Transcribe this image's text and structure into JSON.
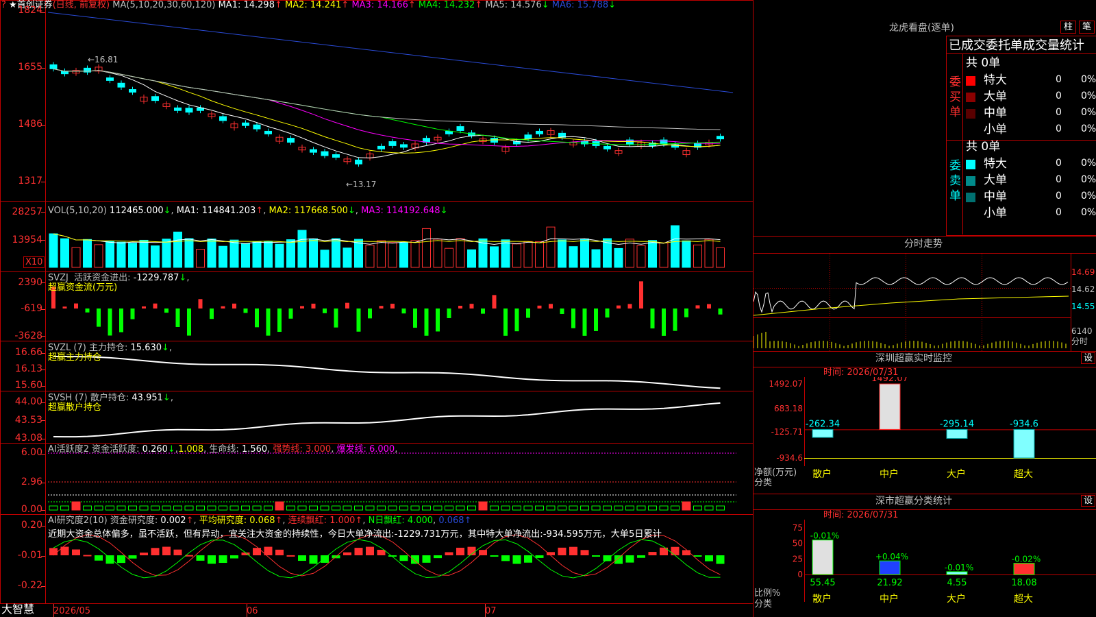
{
  "colors": {
    "up": "#ff3030",
    "down": "#00ffff",
    "frame": "#c00000",
    "ma1": "#ffffff",
    "ma2": "#ffff00",
    "ma3": "#ff00ff",
    "ma4": "#00ff00",
    "ma5": "#c0c0c0",
    "ma6": "#2a4bd7",
    "yellow": "#ffff00",
    "green": "#00ff00"
  },
  "header": {
    "marker": "?",
    "stock": "★首创证券",
    "period": "(日线, 前复权)",
    "ma_params": "MA(5,10,20,30,60,120)",
    "ma": [
      {
        "label": "MA1:",
        "value": "14.298",
        "arrow": "↑"
      },
      {
        "label": "MA2:",
        "value": "14.241",
        "arrow": "↑"
      },
      {
        "label": "MA3:",
        "value": "14.166",
        "arrow": "↑"
      },
      {
        "label": "MA4:",
        "value": "14.232",
        "arrow": "↑"
      },
      {
        "label": "MA5:",
        "value": "14.576",
        "arrow": "↓"
      },
      {
        "label": "MA6:",
        "value": "15.788",
        "arrow": "↓"
      }
    ]
  },
  "price_axis": [
    "1824",
    "1655",
    "1486",
    "1317"
  ],
  "price_marks": {
    "high": "←16.81",
    "low": "←13.17"
  },
  "vol": {
    "title": "VOL(5,10,20)",
    "value": "112465.000",
    "value_arrow": "↓",
    "ma": [
      {
        "label": "MA1:",
        "value": "114841.203",
        "arrow": "↑"
      },
      {
        "label": "MA2:",
        "value": "117668.500",
        "arrow": "↓"
      },
      {
        "label": "MA3:",
        "value": "114192.648",
        "arrow": "↓"
      }
    ],
    "axis": [
      "28257",
      "13954"
    ],
    "unit": "X10"
  },
  "svzj": {
    "title": "SVZJ",
    "label": "活跃资金进出:",
    "value": "-1229.787",
    "arrow": "↓",
    "sub": "超赢资金流(万元)",
    "axis": [
      "2390",
      "-619",
      "-3628"
    ]
  },
  "svzl": {
    "title": "SVZL (7)",
    "label": "主力持仓:",
    "value": "15.630",
    "arrow": "↓",
    "sub": "超赢主力持仓",
    "axis": [
      "16.66",
      "16.13",
      "15.60"
    ]
  },
  "svsh": {
    "title": "SVSH (7)",
    "label": "散户持仓:",
    "value": "43.951",
    "arrow": "↓",
    "sub": "超赢散户持仓",
    "axis": [
      "44.00",
      "43.53",
      "43.08"
    ]
  },
  "ai1": {
    "title": "AI活跃度2",
    "label": "资金活跃度:",
    "value": "0.260",
    "arrow": "↓",
    "v2": "1.008",
    "l3": "生命线:",
    "v3": "1.560",
    "l4": "强势线:",
    "v4": "3.000",
    "l5": "爆发线:",
    "v5": "6.000",
    "axis": [
      "6.00",
      "2.96",
      "0.00"
    ]
  },
  "ai2": {
    "title": "AI研究度2(10)",
    "label": "资金研究度:",
    "value": "0.002",
    "arrow": "↑",
    "l2": "平均研究度:",
    "v2": "0.068",
    "l3": "连续飘红:",
    "v3": "1.000",
    "l4": "N日飘红:",
    "v4": "4.000",
    "v5": "0.068",
    "axis": [
      "0.20",
      "-0.01",
      "-0.22"
    ],
    "comment": "近期大资金总体偏多，虽不活跃，但有异动，宜关注大资金的持续性，今日大单净流出:-1229.731万元，其中特大单净流出:-934.595万元，大单5日累计"
  },
  "footer": {
    "brand": "大智慧",
    "dates": [
      "2026/05",
      "06",
      "07"
    ]
  },
  "dragon": {
    "title": "龙虎看盘(逐单)",
    "btn1": "柱",
    "btn2": "笔",
    "table_title": "已成交委托单成交量统计",
    "buy": {
      "side": "委买单",
      "total": "共 0单",
      "rows": [
        {
          "name": "特大",
          "count": "0",
          "pct": "0%",
          "color": "#ff0000"
        },
        {
          "name": "大单",
          "count": "0",
          "pct": "0%",
          "color": "#8b0000"
        },
        {
          "name": "中单",
          "count": "0",
          "pct": "0%",
          "color": "#5a0000"
        },
        {
          "name": "小单",
          "count": "0",
          "pct": "0%",
          "color": "#000000"
        }
      ]
    },
    "sell": {
      "side": "委卖单",
      "total": "共 0单",
      "rows": [
        {
          "name": "特大",
          "count": "0",
          "pct": "0%",
          "color": "#00ffff"
        },
        {
          "name": "大单",
          "count": "0",
          "pct": "0%",
          "color": "#008b8b"
        },
        {
          "name": "中单",
          "count": "0",
          "pct": "0%",
          "color": "#007070"
        },
        {
          "name": "小单",
          "count": "0",
          "pct": "0%",
          "color": "#000000"
        }
      ]
    }
  },
  "intraday": {
    "title": "分时走势",
    "axis": [
      "14.69",
      "14.62",
      "14.55"
    ],
    "vol_label": "6140",
    "vol_unit": "分时"
  },
  "monitor": {
    "title": "深圳超赢实时监控",
    "btn": "设",
    "time": "时间: 2026/07/31",
    "axis": [
      "1492.07",
      "683.18",
      "-125.71",
      "-934.6"
    ],
    "ylabel": "净额(万元)",
    "xlabel": "分类"
  },
  "stats": {
    "title": "深市超赢分类统计",
    "btn": "设",
    "time": "时间: 2026/07/31",
    "axis": [
      "75",
      "50",
      "25",
      "0"
    ],
    "ylabel": "比例%",
    "xlabel": "分类"
  },
  "chart_data": [
    {
      "type": "candlestick",
      "title": "首创证券 日线",
      "ylim": [
        13.17,
        18.24
      ],
      "x": [
        "2026/05",
        "06",
        "07"
      ],
      "ohlc_note": "daily candles",
      "ma_latest": {
        "MA1": 14.298,
        "MA2": 14.241,
        "MA3": 14.166,
        "MA4": 14.232,
        "MA5": 14.576,
        "MA6": 15.788
      },
      "high": 16.81,
      "low": 13.17
    },
    {
      "type": "bar",
      "title": "深圳超赢实时监控",
      "categories": [
        "散户",
        "中户",
        "大户",
        "超大"
      ],
      "values": [
        -262.34,
        1492.07,
        -295.14,
        -934.6
      ],
      "ylim": [
        -934.6,
        1492.07
      ]
    },
    {
      "type": "bar",
      "title": "深市超赢分类统计",
      "categories": [
        "散户",
        "中户",
        "大户",
        "超大"
      ],
      "series": [
        {
          "name": "比例",
          "values": [
            55.45,
            21.92,
            4.55,
            18.08
          ]
        },
        {
          "name": "变化",
          "values": [
            -0.01,
            0.04,
            -0.01,
            -0.02
          ]
        }
      ],
      "labels_top": [
        "-0.01%",
        "+0.04%",
        "-0.01%",
        "-0.02%"
      ],
      "labels_bottom": [
        "55.45",
        "21.92",
        "4.55",
        "18.08"
      ],
      "ylim": [
        0,
        75
      ]
    }
  ]
}
